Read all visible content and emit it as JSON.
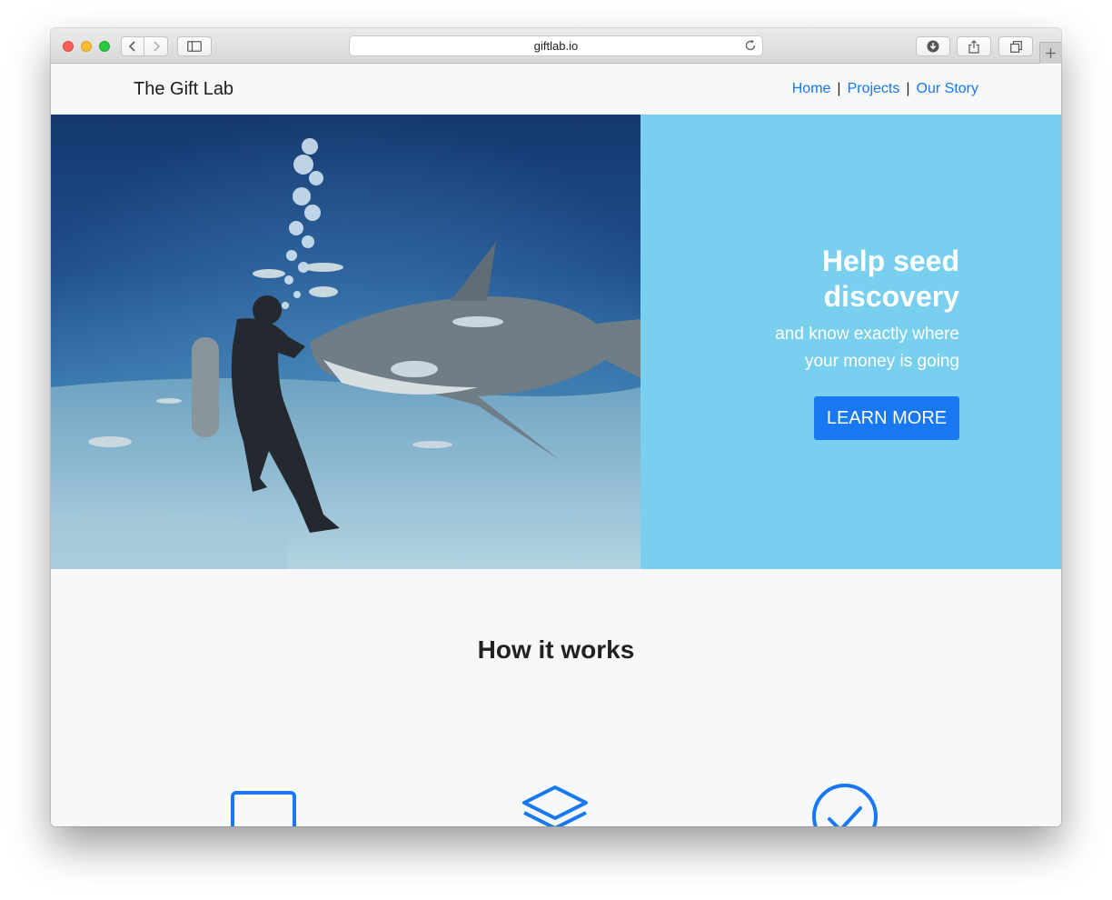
{
  "browser": {
    "url": "giftlab.io"
  },
  "site": {
    "brand": "The Gift Lab",
    "nav": [
      {
        "label": "Home"
      },
      {
        "label": "Projects"
      },
      {
        "label": "Our Story"
      }
    ],
    "separator": "|"
  },
  "hero": {
    "title_line1": "Help seed",
    "title_line2": "discovery",
    "subtitle_line1": "and know exactly where",
    "subtitle_line2": "your money is going",
    "cta_label": "LEARN MORE",
    "panel_color": "#78cfee",
    "accent_color": "#1778f2"
  },
  "how_it_works": {
    "title": "How it works",
    "icons": [
      "square-icon",
      "layers-icon",
      "check-circle-icon"
    ]
  }
}
